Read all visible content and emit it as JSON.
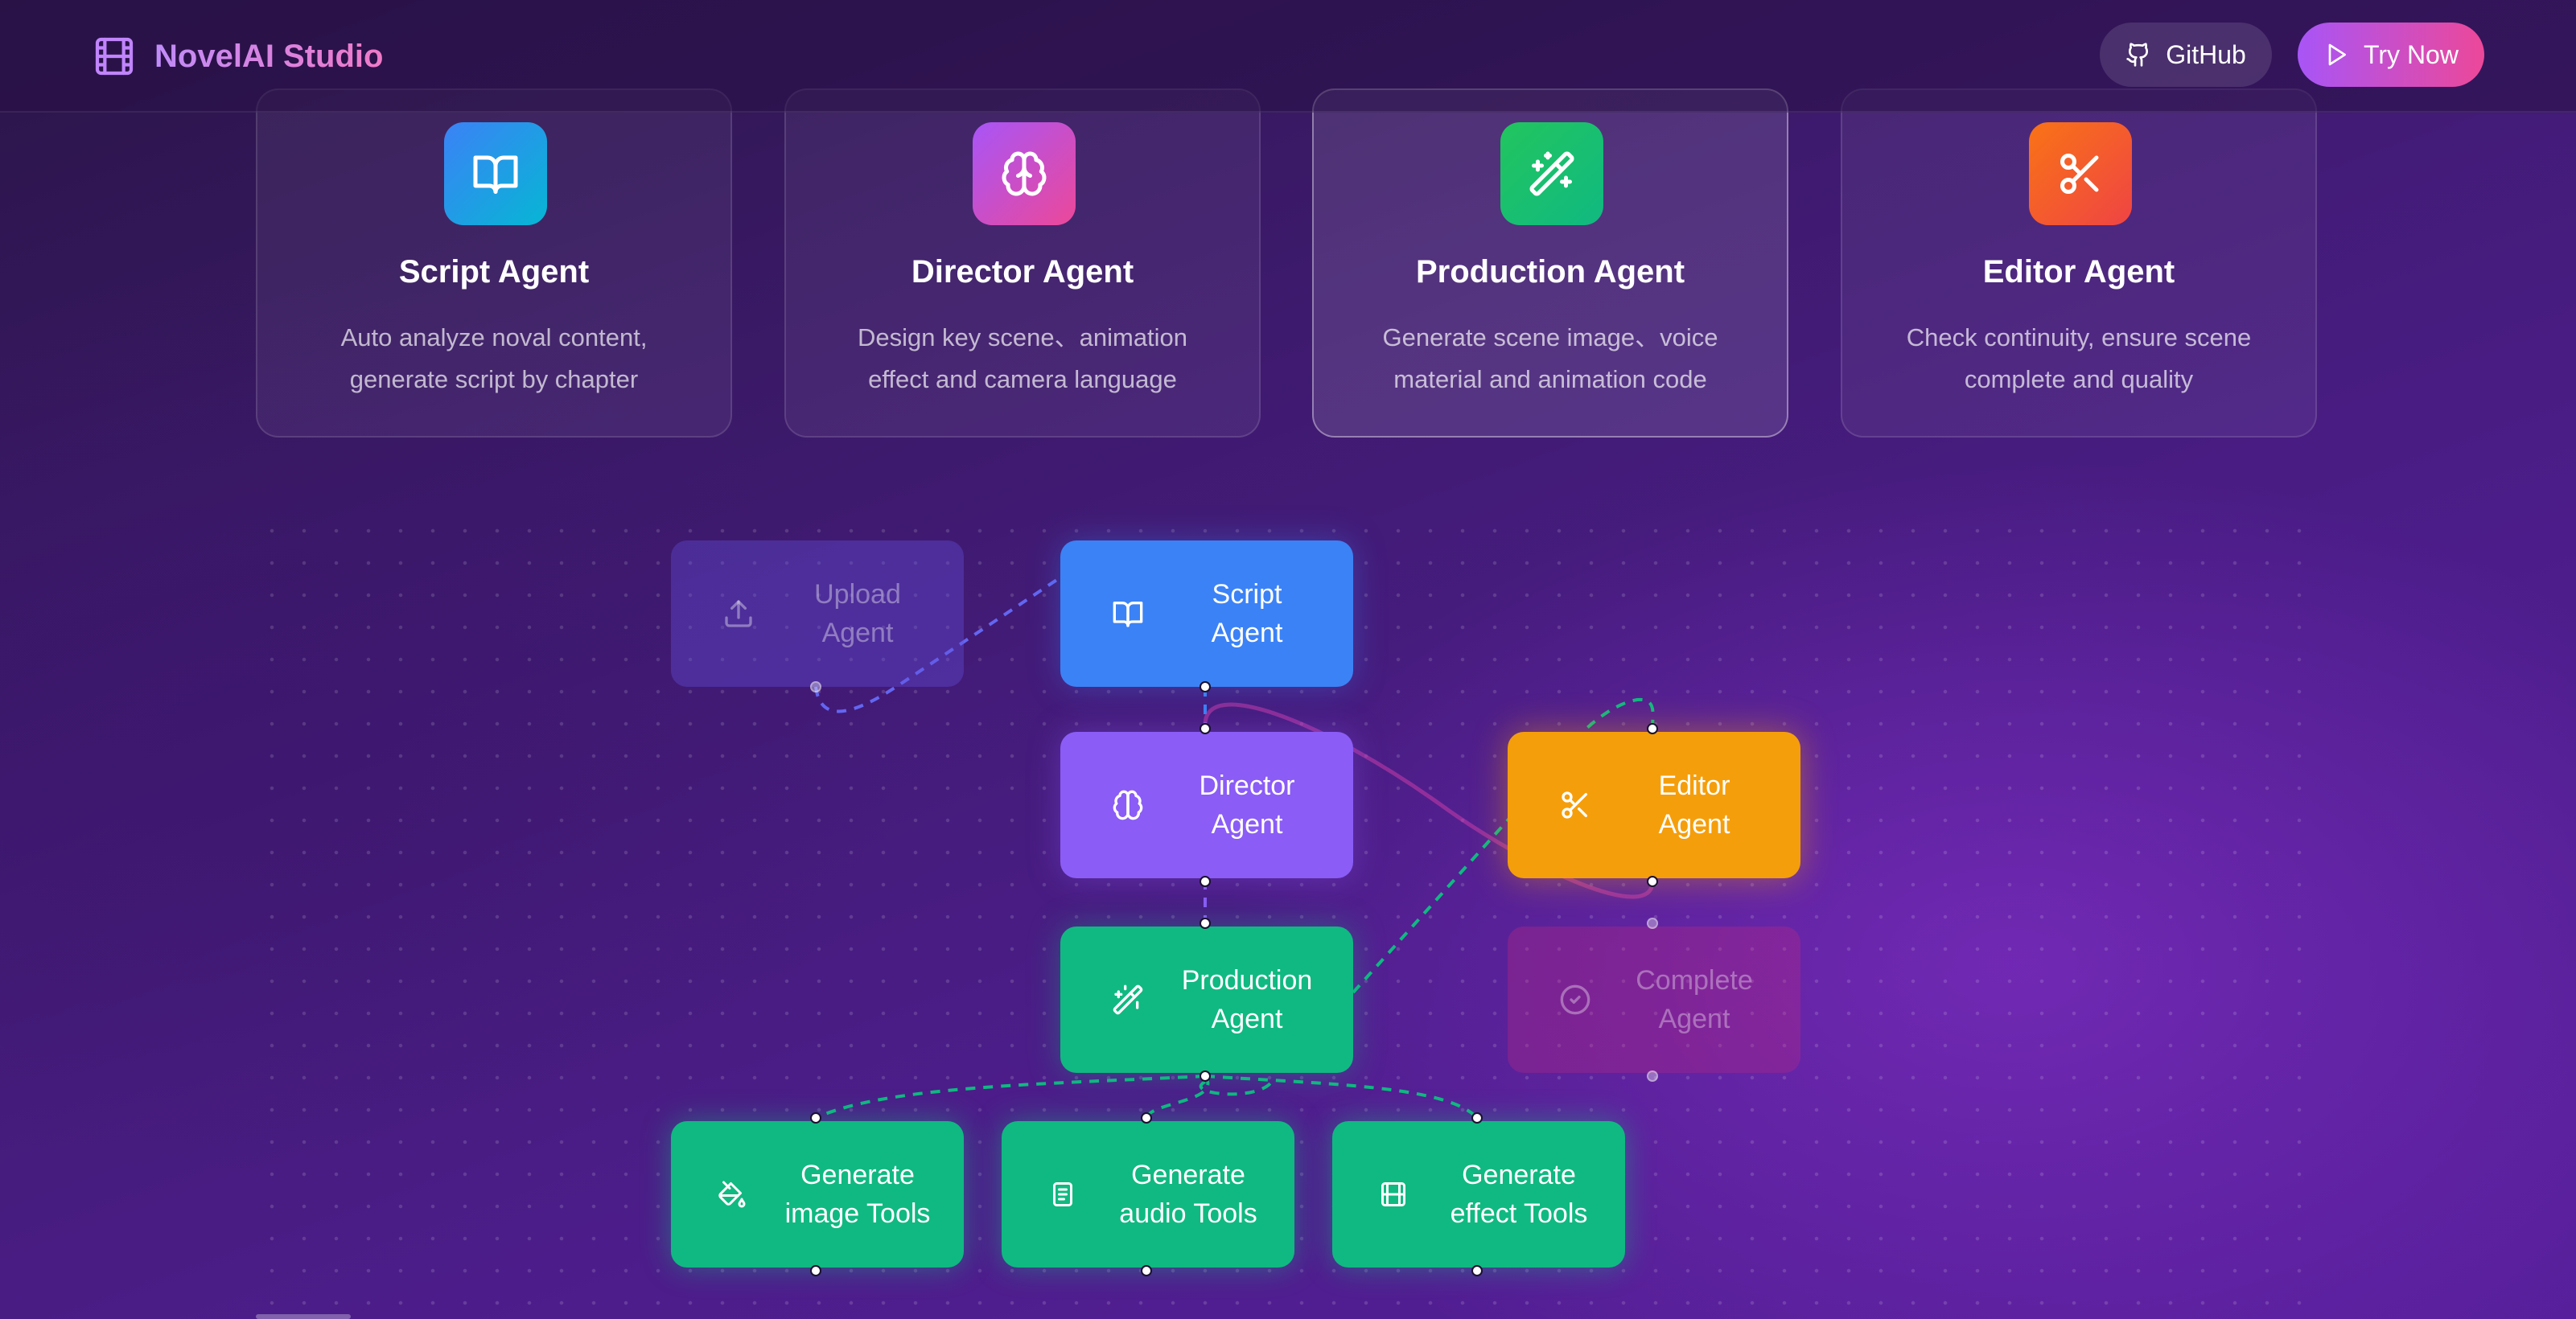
{
  "header": {
    "brand": "NovelAI Studio",
    "brand_icon": "film-icon",
    "github_label": "GitHub",
    "try_label": "Try Now"
  },
  "cards": [
    {
      "title": "Script Agent",
      "desc_line1": "Auto analyze noval content,",
      "desc_line2": "generate script by chapter",
      "icon": "book-open-icon",
      "color": "#0ea5e9"
    },
    {
      "title": "Director Agent",
      "desc_line1": "Design key scene、animation",
      "desc_line2": "effect and camera language",
      "icon": "brain-icon",
      "color": "#d946ef"
    },
    {
      "title": "Production Agent",
      "desc_line1": "Generate scene image、voice",
      "desc_line2": "material and animation code",
      "icon": "wand-icon",
      "color": "#22c55e"
    },
    {
      "title": "Editor Agent",
      "desc_line1": "Check continuity, ensure scene",
      "desc_line2": "complete and quality",
      "icon": "scissors-icon",
      "color": "#f97316"
    }
  ],
  "flow": {
    "upload": {
      "line1": "Upload",
      "line2": "Agent"
    },
    "script": {
      "line1": "Script",
      "line2": "Agent"
    },
    "director": {
      "line1": "Director",
      "line2": "Agent"
    },
    "production": {
      "line1": "Production",
      "line2": "Agent"
    },
    "editor": {
      "line1": "Editor",
      "line2": "Agent"
    },
    "complete": {
      "line1": "Complete",
      "line2": "Agent"
    },
    "image_tools": {
      "line1": "Generate",
      "line2": "image Tools"
    },
    "audio_tools": {
      "line1": "Generate",
      "line2": "audio Tools"
    },
    "effect_tools": {
      "line1": "Generate",
      "line2": "effect Tools"
    }
  },
  "colors": {
    "script": "#3b82f6",
    "director": "#8b5cf6",
    "production": "#10b981",
    "editor": "#f59e0b",
    "try_now_gradient": [
      "#a855f7",
      "#ec4899"
    ]
  }
}
